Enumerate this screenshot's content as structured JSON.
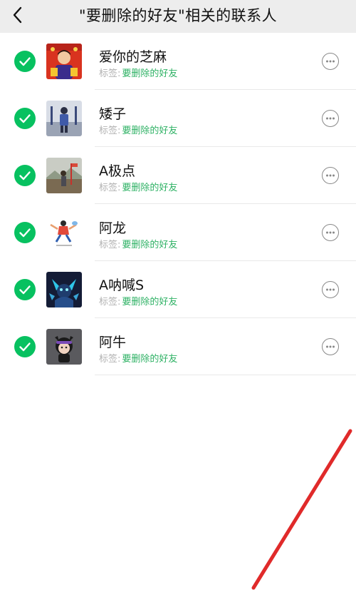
{
  "header": {
    "title": "\"要删除的好友\"相关的联系人",
    "back_icon": "chevron-left-icon"
  },
  "contacts": [
    {
      "name": "爱你的芝麻",
      "tag_prefix": "标签:",
      "tag_value": "要删除的好友",
      "checked": true
    },
    {
      "name": "矮子",
      "tag_prefix": "标签:",
      "tag_value": "要删除的好友",
      "checked": true
    },
    {
      "name": "A极点",
      "tag_prefix": "标签:",
      "tag_value": "要删除的好友",
      "checked": true
    },
    {
      "name": "阿龙",
      "tag_prefix": "标签:",
      "tag_value": "要删除的好友",
      "checked": true
    },
    {
      "name": "A呐喊S",
      "tag_prefix": "标签:",
      "tag_value": "要删除的好友",
      "checked": true
    },
    {
      "name": "阿牛",
      "tag_prefix": "标签:",
      "tag_value": "要删除的好友",
      "checked": true
    }
  ],
  "colors": {
    "check_green": "#07c160",
    "tag_green": "#2fb265",
    "header_bg": "#ededed",
    "annotation_red": "#e02a2a"
  },
  "icons": {
    "check": "checkmark-icon",
    "more": "more-options-icon"
  }
}
